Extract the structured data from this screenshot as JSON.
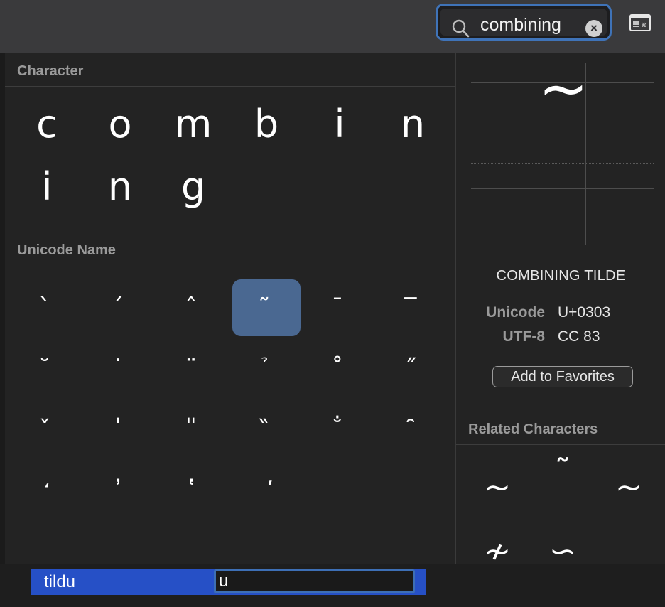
{
  "search": {
    "value": "combining",
    "clear_icon": "clear-circle-icon"
  },
  "toolbar": {
    "view_icon": "view-toggle-icon"
  },
  "character_section": {
    "label": "Character",
    "chars": [
      "c",
      "o",
      "m",
      "b",
      "i",
      "n",
      "i",
      "n",
      "g"
    ]
  },
  "unicode_section": {
    "label": "Unicode Name",
    "marks": [
      "̀",
      "́",
      "̂",
      "̃",
      "̄",
      "̅",
      "̆",
      "̇",
      "̈",
      "̉",
      "̊",
      "̋",
      "̌",
      "̍",
      "̎",
      "̏",
      "̐",
      "̑",
      "̒",
      "̓",
      "̔",
      "̕",
      "",
      ""
    ],
    "selected_index": 3
  },
  "detail": {
    "glyph": "~",
    "name": "COMBINING TILDE",
    "unicode_key": "Unicode",
    "unicode_value": "U+0303",
    "utf8_key": "UTF-8",
    "utf8_value": "CC 83",
    "favorites_button": "Add to Favorites"
  },
  "related": {
    "label": "Related Characters",
    "chars": [
      "~",
      "˜",
      "∼",
      "≁",
      "∽"
    ]
  },
  "candidate": {
    "label": "tildu",
    "input_value": "u"
  },
  "colors": {
    "selected_cell": "#4a6891",
    "search_focus": "#3f73b8",
    "candidate_row": "#2650c6"
  }
}
